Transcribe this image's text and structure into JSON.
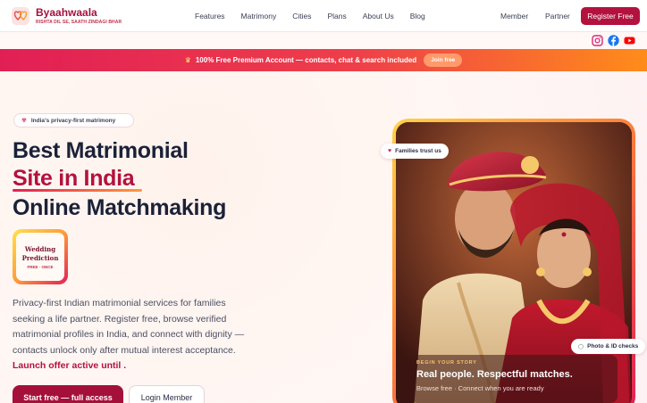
{
  "brand": {
    "name": "Byaahwaala",
    "tagline": "RISHTA DIL SE, SAATH ZINDAGI BHAR"
  },
  "nav": {
    "links": [
      "Features",
      "Matrimony",
      "Cities",
      "Plans",
      "About Us",
      "Blog"
    ],
    "member_label": "Member",
    "partner_label": "Partner",
    "register_label": "Register Free"
  },
  "social": {
    "icons": [
      "instagram-icon",
      "facebook-icon",
      "youtube-icon"
    ],
    "colors": {
      "instagram": "#d62976",
      "facebook": "#1877f2",
      "youtube": "#ff0000"
    }
  },
  "promo": {
    "text": "100% Free Premium Account — contacts, chat & search included",
    "button": "Join free"
  },
  "hero": {
    "pill": "India's privacy-first matrimony",
    "line1": "Best Matrimonial",
    "line2": "Site in India",
    "line3": "Online Matchmaking",
    "badge_line1": "Wedding",
    "badge_line2": "Prediction",
    "badge_sub": "FREE · ONCE",
    "description": "Privacy-first Indian matrimonial services for families seeking a life partner. Register free, browse verified matrimonial profiles in India, and connect with dignity — contacts unlock only after mutual interest acceptance.",
    "launch_text": "Launch offer active until .",
    "primary_button": "Start free — full access",
    "secondary_button": "Login Member"
  },
  "card": {
    "families_pill": "Families trust us",
    "photo_pill": "Photo & ID checks",
    "kicker": "BEGIN YOUR STORY",
    "title": "Real people. Respectful matches.",
    "subtitle": "Browse free · Connect when you are ready"
  },
  "colors": {
    "brand": "#b3123e",
    "accent_orange": "#ff8c1a",
    "text_dark": "#1b2138"
  }
}
